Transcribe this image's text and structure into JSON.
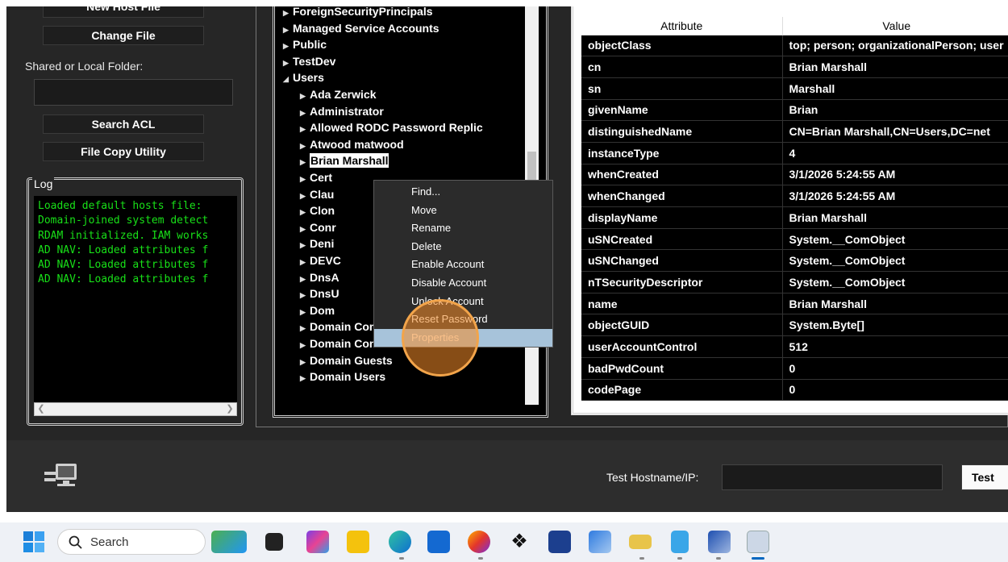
{
  "left_panel": {
    "buttons": {
      "new_host_file": "New Host File",
      "change_file": "Change File",
      "search_acl": "Search ACL",
      "file_copy": "File Copy Utility"
    },
    "shared_folder_label": "Shared or Local Folder:",
    "log_title": "Log",
    "log_lines": [
      "Loaded default hosts file:",
      "Domain-joined system detect",
      "RDAM initialized. IAM works",
      "AD NAV: Loaded attributes f",
      "AD NAV: Loaded attributes f",
      "AD NAV: Loaded attributes f"
    ]
  },
  "tree": {
    "items": [
      {
        "label": "ForeignSecurityPrincipals",
        "level": 0,
        "expanded": false
      },
      {
        "label": "Managed Service Accounts",
        "level": 0,
        "expanded": false
      },
      {
        "label": "Public",
        "level": 0,
        "expanded": false
      },
      {
        "label": "TestDev",
        "level": 0,
        "expanded": false
      },
      {
        "label": "Users",
        "level": 0,
        "expanded": true
      },
      {
        "label": "Ada Zerwick",
        "level": 1,
        "expanded": false
      },
      {
        "label": "Administrator",
        "level": 1,
        "expanded": false
      },
      {
        "label": "Allowed RODC Password Replic",
        "level": 1,
        "expanded": false
      },
      {
        "label": "Atwood matwood",
        "level": 1,
        "expanded": false
      },
      {
        "label": "Brian Marshall",
        "level": 1,
        "expanded": false,
        "selected": true
      },
      {
        "label": "Cert",
        "level": 1,
        "expanded": false
      },
      {
        "label": "Clau",
        "level": 1,
        "expanded": false
      },
      {
        "label": "Clon",
        "level": 1,
        "expanded": false
      },
      {
        "label": "Conr",
        "level": 1,
        "expanded": false
      },
      {
        "label": "Deni",
        "level": 1,
        "expanded": false
      },
      {
        "label": "DEVC",
        "level": 1,
        "expanded": false
      },
      {
        "label": "DnsA",
        "level": 1,
        "expanded": false
      },
      {
        "label": "DnsU",
        "level": 1,
        "expanded": false
      },
      {
        "label": "Dom",
        "level": 1,
        "expanded": false
      },
      {
        "label": "Domain Computers",
        "level": 1,
        "expanded": false
      },
      {
        "label": "Domain Controllers",
        "level": 1,
        "expanded": false
      },
      {
        "label": "Domain Guests",
        "level": 1,
        "expanded": false
      },
      {
        "label": "Domain Users",
        "level": 1,
        "expanded": false
      }
    ]
  },
  "context_menu": {
    "items": [
      "Find...",
      "Move",
      "Rename",
      "Delete",
      "Enable Account",
      "Disable Account",
      "Unlock Account",
      "Reset Password",
      "Properties"
    ],
    "highlighted": "Properties"
  },
  "attributes": {
    "header": {
      "attribute": "Attribute",
      "value": "Value"
    },
    "rows": [
      {
        "attr": "objectClass",
        "value": "top; person; organizationalPerson; user"
      },
      {
        "attr": "cn",
        "value": "Brian Marshall"
      },
      {
        "attr": "sn",
        "value": "Marshall"
      },
      {
        "attr": "givenName",
        "value": "Brian"
      },
      {
        "attr": "distinguishedName",
        "value": "CN=Brian Marshall,CN=Users,DC=net"
      },
      {
        "attr": "instanceType",
        "value": "4"
      },
      {
        "attr": "whenCreated",
        "value": "3/1/2026 5:24:55 AM"
      },
      {
        "attr": "whenChanged",
        "value": "3/1/2026 5:24:55 AM"
      },
      {
        "attr": "displayName",
        "value": "Brian Marshall"
      },
      {
        "attr": "uSNCreated",
        "value": "System.__ComObject"
      },
      {
        "attr": "uSNChanged",
        "value": "System.__ComObject"
      },
      {
        "attr": "nTSecurityDescriptor",
        "value": "System.__ComObject"
      },
      {
        "attr": "name",
        "value": "Brian Marshall"
      },
      {
        "attr": "objectGUID",
        "value": "System.Byte[]"
      },
      {
        "attr": "userAccountControl",
        "value": "512"
      },
      {
        "attr": "badPwdCount",
        "value": "0"
      },
      {
        "attr": "codePage",
        "value": "0"
      }
    ]
  },
  "bottom": {
    "test_label": "Test Hostname/IP:",
    "test_button": "Test"
  },
  "taskbar": {
    "search_placeholder": "Search"
  }
}
